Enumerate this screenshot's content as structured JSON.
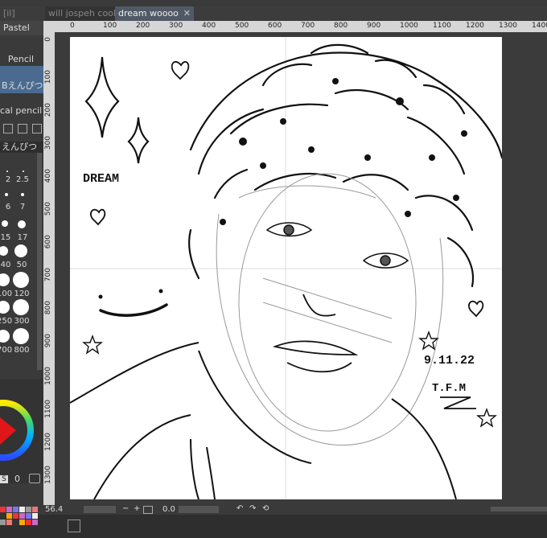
{
  "tabs": {
    "left_cut": "[il]",
    "first": "will jospeh cook",
    "active": "dream woooo",
    "close": "✕"
  },
  "left_panel": {
    "tool_header": "Pastel",
    "pencil_label": "Pencil",
    "selected_brush": "Bえんぴつ",
    "vertical_pencil": "cal pencil",
    "brush_tab": "えんぴつ",
    "brush_sizes_row1": [
      "2",
      "2.5"
    ],
    "brush_sizes_row2": [
      "6",
      "7"
    ],
    "brush_sizes_row3": [
      "15",
      "17"
    ],
    "brush_sizes_row4": [
      "40",
      "50"
    ],
    "brush_sizes_row5": [
      "100",
      "120"
    ],
    "brush_sizes_row6": [
      "250",
      "300"
    ],
    "brush_sizes_row7": [
      "700",
      "800"
    ],
    "color_s_label": "S",
    "color_value": "0"
  },
  "ruler": {
    "top": [
      "0",
      "100",
      "200",
      "300",
      "400",
      "500",
      "600",
      "700",
      "800",
      "900",
      "1000",
      "1100",
      "1200",
      "1300",
      "1400"
    ],
    "left": [
      "0",
      "100",
      "200",
      "300",
      "400",
      "500",
      "600",
      "700",
      "800",
      "900",
      "1000",
      "1100",
      "1200",
      "1300"
    ]
  },
  "status": {
    "zoom": "56.4",
    "angle": "0.0"
  },
  "drawing": {
    "word": "DREAM",
    "date": "9.11.22",
    "initials": "T.F.M"
  },
  "colors": {
    "accent_tab": "#505a66",
    "selection": "#4a6a90"
  }
}
